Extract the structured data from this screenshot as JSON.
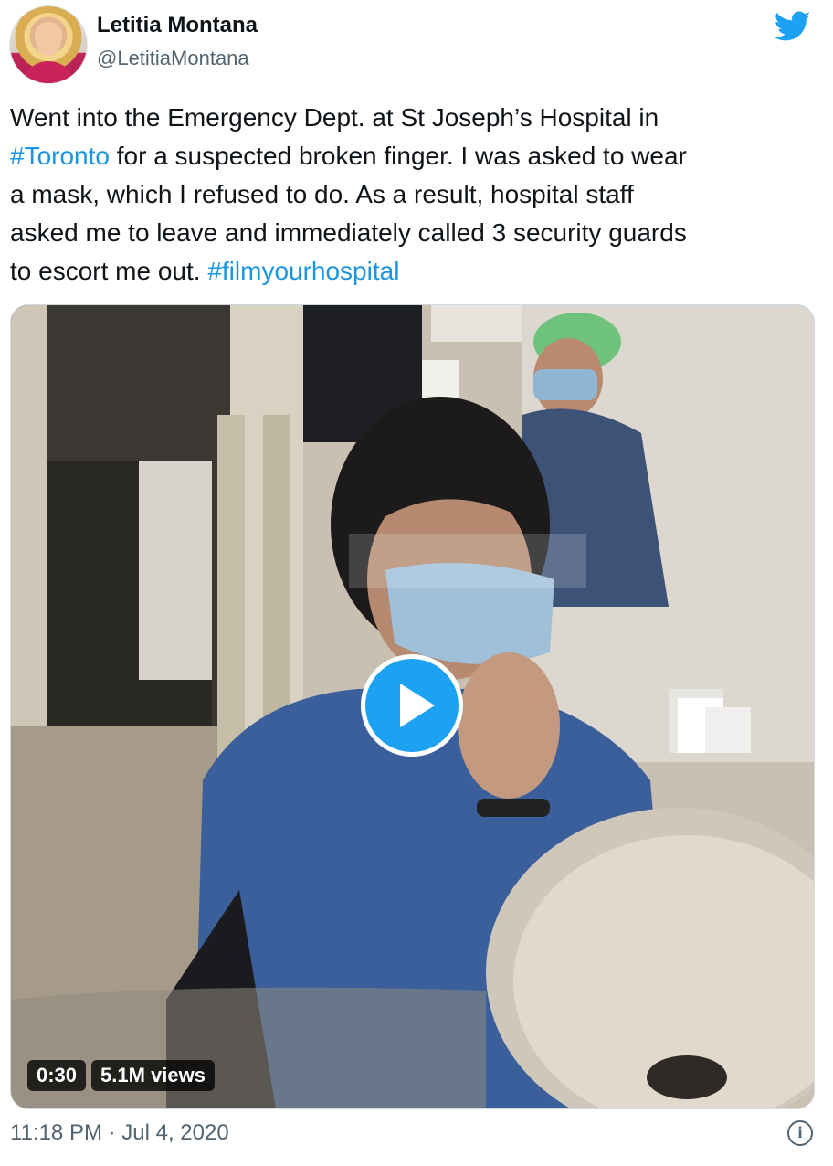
{
  "author": {
    "name": "Letitia Montana",
    "handle": "@LetitiaMontana"
  },
  "tweet": {
    "lines": [
      [
        "Went into the Emergency Dept. at St Joseph’s Hospital in"
      ],
      [
        "#Toronto",
        " for a suspected broken finger. I was asked to wear"
      ],
      [
        "a mask, which I refused to do. As a result, hospital staff"
      ],
      [
        "asked me to leave and immediately called 3 security guards"
      ],
      [
        "to escort me out. ",
        "#filmyourhospital"
      ]
    ],
    "hashtag_toronto": "#Toronto",
    "hashtag_film": "#filmyourhospital"
  },
  "video": {
    "duration": "0:30",
    "views": "5.1M views"
  },
  "footer": {
    "timestamp": "11:18 PM · Jul 4, 2020",
    "info_icon": "ⓘ"
  },
  "colors": {
    "accent": "#1da1f2",
    "hashtag": "#1b95e0",
    "muted": "#536471"
  },
  "icons": {
    "brand": "twitter-bird-icon",
    "play": "play-icon",
    "info": "info-icon"
  }
}
